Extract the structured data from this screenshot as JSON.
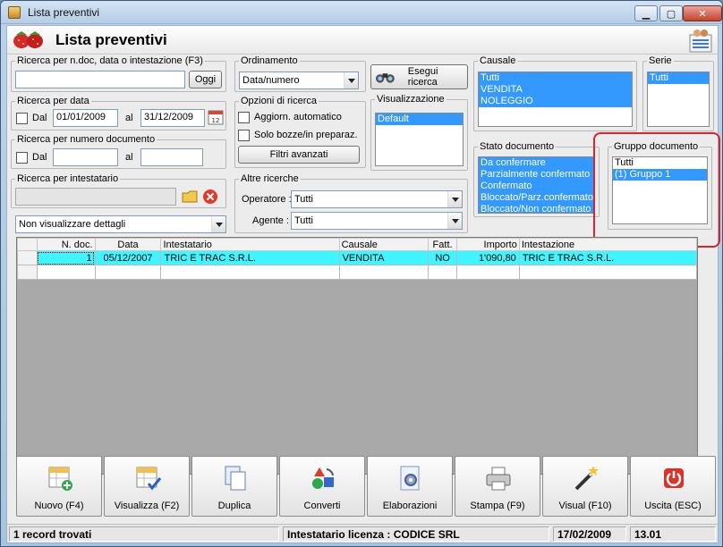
{
  "window": {
    "title": "Lista preventivi"
  },
  "header": {
    "title": "Lista preventivi"
  },
  "search_ndoc": {
    "legend": "Ricerca per n.doc, data o intestazione (F3)",
    "value": "",
    "today_button": "Oggi"
  },
  "ordering": {
    "legend": "Ordinamento",
    "selected": "Data/numero"
  },
  "execute_search": {
    "label": "Esegui ricerca"
  },
  "search_date": {
    "legend": "Ricerca per data",
    "from_label": "Dal",
    "from_value": "01/01/2009",
    "to_label": "al",
    "to_value": "31/12/2009"
  },
  "search_options": {
    "legend": "Opzioni di ricerca",
    "auto_update": "Aggiorn. automatico",
    "drafts_only": "Solo bozze/in preparaz.",
    "advanced_filters": "Filtri avanzati"
  },
  "display": {
    "legend": "Visualizzazione",
    "items": [
      "Default"
    ]
  },
  "search_docnum": {
    "legend": "Ricerca per numero documento",
    "from_label": "Dal",
    "from_value": "",
    "to_label": "al",
    "to_value": ""
  },
  "search_holder": {
    "legend": "Ricerca per intestatario",
    "value": ""
  },
  "details_select": {
    "selected": "Non visualizzare dettagli"
  },
  "other_searches": {
    "legend": "Altre ricerche",
    "operator_label": "Operatore :",
    "operator_value": "Tutti",
    "agent_label": "Agente :",
    "agent_value": "Tutti"
  },
  "causale": {
    "legend": "Causale",
    "items": [
      "Tutti",
      "VENDITA",
      "NOLEGGIO"
    ]
  },
  "serie": {
    "legend": "Serie",
    "items": [
      "Tutti"
    ]
  },
  "doc_status": {
    "legend": "Stato documento",
    "items": [
      "Da confermare",
      "Parzialmente confermato",
      "Confermato",
      "Bloccato/Parz.confermato",
      "Bloccato/Non confermato"
    ]
  },
  "doc_group": {
    "legend": "Gruppo documento",
    "items": [
      "Tutti",
      "(1) Gruppo 1"
    ],
    "selected_index": 1
  },
  "table": {
    "columns": [
      "N. doc.",
      "Data",
      "Intestatario",
      "Causale",
      "Fatt.",
      "Importo",
      "Intestazione"
    ],
    "rows": [
      [
        "1",
        "05/12/2007",
        "TRIC E TRAC S.R.L.",
        "VENDITA",
        "NO",
        "1'090,80",
        "TRIC E TRAC S.R.L."
      ]
    ]
  },
  "toolbar": {
    "new": "Nuovo (F4)",
    "view": "Visualizza (F2)",
    "duplicate": "Duplica",
    "convert": "Converti",
    "processing": "Elaborazioni",
    "print": "Stampa (F9)",
    "visual": "Visual (F10)",
    "exit": "Uscita (ESC)"
  },
  "status": {
    "records": "1 record trovati",
    "license": "Intestatario licenza : CODICE SRL",
    "date": "17/02/2009",
    "time": "13.01"
  },
  "colors": {
    "accent_select": "#3399ff",
    "row_highlight": "#3ff5ff",
    "ring": "#d8242a"
  }
}
